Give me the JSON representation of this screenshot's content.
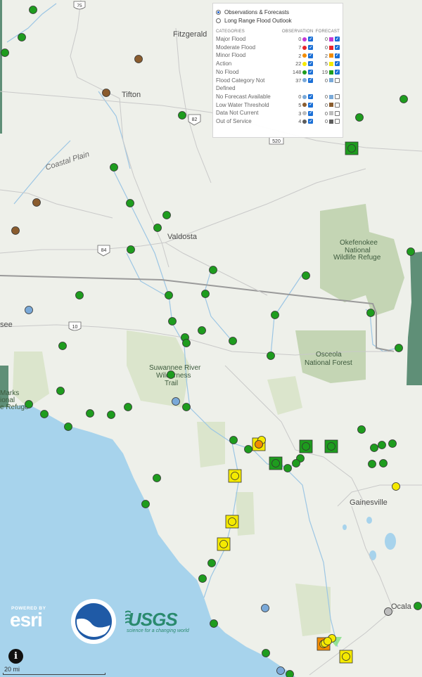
{
  "map": {
    "colors": {
      "water": "#a7d3ec",
      "land": "#eef0ea",
      "park": "#dbe5cc",
      "park_dark": "#bcd0aa",
      "wetland": "#5f8f77",
      "road": "#b0b0b0",
      "highway": "#f0f0f0",
      "river": "#9cc6e4",
      "no_flood": "#1e9c1e",
      "action": "#f5ea00",
      "minor": "#f28c00",
      "no_category": "#7aa9d8",
      "low_water": "#8a5c2e",
      "not_current": "#bdbdbd",
      "out_of_service": "#5c5c5c"
    },
    "labels": {
      "fitzgerald": "Fitzgerald",
      "tifton": "Tifton",
      "coastal_plain": "Coastal Plain",
      "valdosta": "Valdosta",
      "okefenokee_1": "Okefenokee",
      "okefenokee_2": "National",
      "okefenokee_3": "Wildlife Refuge",
      "osceola_1": "Osceola",
      "osceola_2": "National Forest",
      "suwannee_1": "Suwannee River",
      "suwannee_2": "Wilderness",
      "suwannee_3": "Trail",
      "gainesville": "Gainesville",
      "ocala": "Ocala",
      "see": "see",
      "marks_1": "Marks",
      "marks_2": "ional",
      "marks_3": "e Refuge"
    },
    "shields": {
      "i75": "75",
      "us82": "82",
      "us84": "84",
      "i10": "10",
      "r520": "520"
    }
  },
  "legend": {
    "options": [
      {
        "label": "Observations & Forecasts",
        "selected": true
      },
      {
        "label": "Long Range Flood Outlook",
        "selected": false
      }
    ],
    "headers": {
      "categories": "CATEGORIES",
      "observation": "OBSERVATION",
      "forecast": "FORECAST"
    },
    "rows": [
      {
        "name": "Major Flood",
        "obs": "0",
        "fc": "0",
        "color": "#c43ad6",
        "obs_checked": true,
        "fc_checked": true
      },
      {
        "name": "Moderate Flood",
        "obs": "7",
        "fc": "0",
        "color": "#e8252b",
        "obs_checked": true,
        "fc_checked": true
      },
      {
        "name": "Minor Flood",
        "obs": "2",
        "fc": "2",
        "color": "#f28c00",
        "obs_checked": true,
        "fc_checked": true
      },
      {
        "name": "Action",
        "obs": "22",
        "fc": "5",
        "color": "#f5ea00",
        "obs_checked": true,
        "fc_checked": true
      },
      {
        "name": "No Flood",
        "obs": "148",
        "fc": "19",
        "color": "#1e9c1e",
        "obs_checked": true,
        "fc_checked": true
      },
      {
        "name": "Flood Category Not Defined",
        "obs": "37",
        "fc": "0",
        "color": "#7aa9d8",
        "obs_checked": true,
        "fc_checked": false
      },
      {
        "name": "No Forecast Available",
        "obs": "0",
        "fc": "0",
        "color": "#7aa9d8",
        "obs_checked": true,
        "fc_checked": false
      },
      {
        "name": "Low Water Threshold",
        "obs": "5",
        "fc": "0",
        "color": "#8a5c2e",
        "obs_checked": true,
        "fc_checked": false
      },
      {
        "name": "Data Not Current",
        "obs": "3",
        "fc": "0",
        "color": "#bdbdbd",
        "obs_checked": true,
        "fc_checked": false
      },
      {
        "name": "Out of Service",
        "obs": "4",
        "fc": "0",
        "color": "#5c5c5c",
        "obs_checked": true,
        "fc_checked": false
      }
    ]
  },
  "footer": {
    "esri_powered": "POWERED BY",
    "esri": "esri",
    "usgs": "USGS",
    "usgs_tagline": "science for a changing world",
    "info": "i",
    "scale": "20 mi"
  }
}
